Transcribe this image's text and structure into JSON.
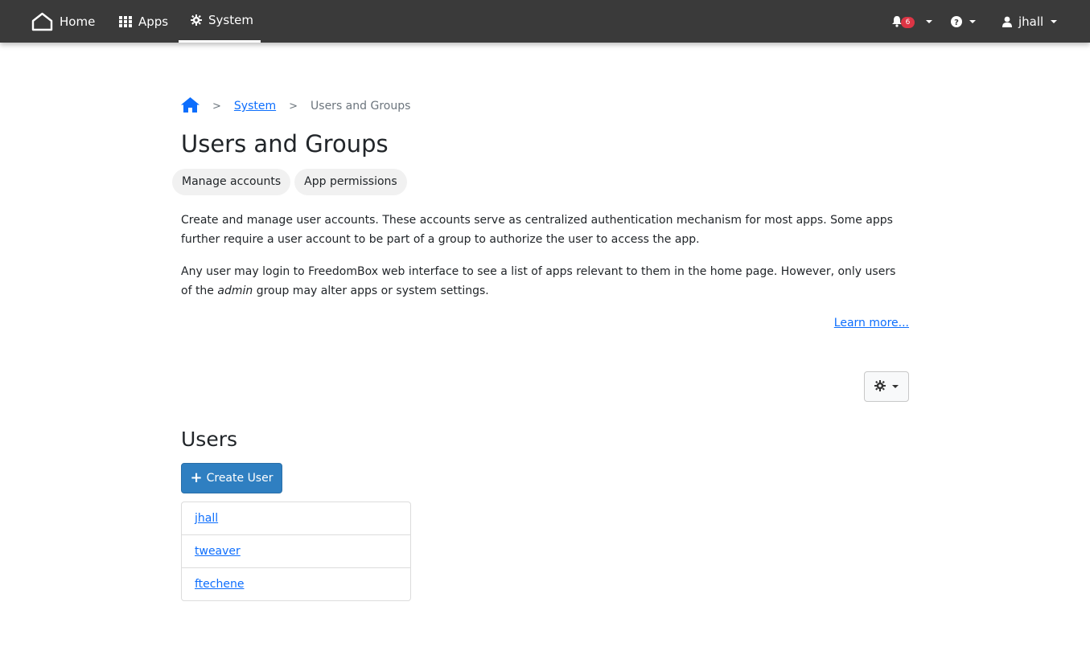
{
  "navbar": {
    "home_label": "Home",
    "apps_label": "Apps",
    "system_label": "System",
    "notifications_count": "6",
    "user_label": "jhall",
    "icons": [
      "home-icon",
      "apps-grid-icon",
      "gear-icon",
      "bell-icon",
      "help-icon",
      "user-icon"
    ]
  },
  "breadcrumb": {
    "separator": ">",
    "system": "System",
    "current": "Users and Groups"
  },
  "page": {
    "title": "Users and Groups",
    "tabs": [
      {
        "label": "Manage accounts"
      },
      {
        "label": "App permissions"
      }
    ],
    "description_1": "Create and manage user accounts. These accounts serve as centralized authentication mechanism for most apps. Some apps further require a user account to be part of a group to authorize the user to access the app.",
    "description_2_pre": "Any user may login to FreedomBox web interface to see a list of apps relevant to them in the home page. However, only users of the ",
    "description_2_em": "admin",
    "description_2_post": " group may alter apps or system settings.",
    "learn_more": "Learn more..."
  },
  "users": {
    "title": "Users",
    "create_label": "Create User",
    "list": [
      {
        "name": "jhall"
      },
      {
        "name": "tweaver"
      },
      {
        "name": "ftechene"
      }
    ]
  },
  "colors": {
    "navbar_bg": "#3a3a3a",
    "link": "#0d6efd",
    "primary_button": "#2f7fc1",
    "badge": "#dc3545"
  }
}
